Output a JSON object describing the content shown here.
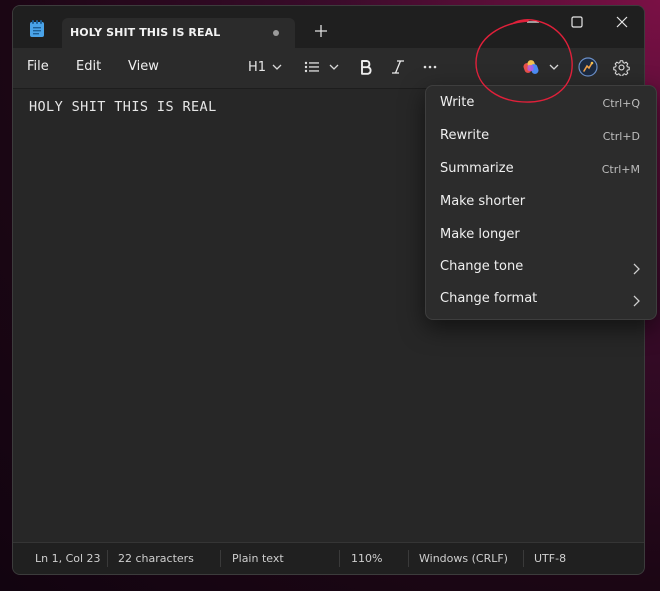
{
  "titlebar": {
    "tab_title": "HOLY SHIT THIS IS REAL"
  },
  "menu": {
    "file": "File",
    "edit": "Edit",
    "view": "View"
  },
  "toolbar": {
    "heading": "H1"
  },
  "editor": {
    "text": "HOLY SHIT THIS IS REAL"
  },
  "copilot_menu": {
    "items": [
      {
        "label": "Write",
        "shortcut": "Ctrl+Q"
      },
      {
        "label": "Rewrite",
        "shortcut": "Ctrl+D"
      },
      {
        "label": "Summarize",
        "shortcut": "Ctrl+M"
      },
      {
        "label": "Make shorter"
      },
      {
        "label": "Make longer"
      },
      {
        "label": "Change tone"
      },
      {
        "label": "Change format"
      }
    ]
  },
  "status": {
    "position": "Ln 1, Col 23",
    "characters": "22 characters",
    "format": "Plain text",
    "zoom": "110%",
    "line_ending": "Windows (CRLF)",
    "encoding": "UTF-8"
  },
  "colors": {
    "annotation": "#e0203a",
    "copilot_red": "#e8504a",
    "copilot_yellow": "#f2c14e",
    "copilot_blue": "#4c8cf5",
    "copilot_purple": "#b45ae8"
  }
}
